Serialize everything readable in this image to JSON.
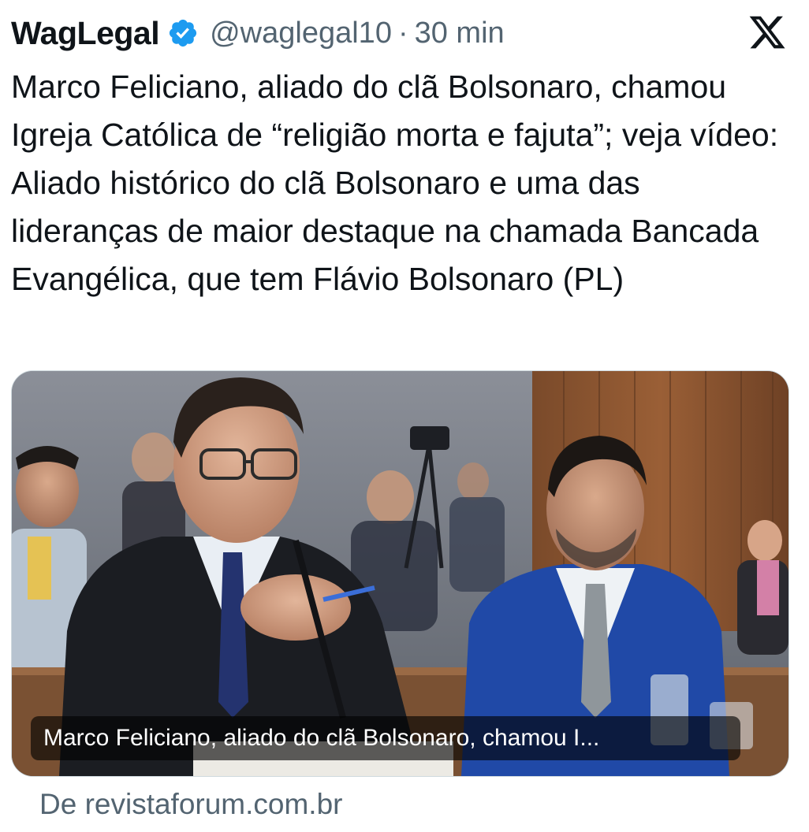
{
  "author": {
    "name": "WagLegal",
    "handle": "@waglegal10",
    "separator": "·",
    "time": "30 min"
  },
  "tweet": {
    "text": "Marco Feliciano, aliado do clã Bolsonaro, chamou Igreja Católica de “religião morta e fajuta”; veja vídeo: Aliado histórico do clã Bolsonaro e uma das lideranças de maior destaque na chamada Bancada Evangélica, que tem Flávio Bolsonaro (PL)"
  },
  "media": {
    "caption": "Marco Feliciano, aliado do clã Bolsonaro, chamou I..."
  },
  "source": {
    "label": "De revistaforum.com.br"
  },
  "icons": {
    "verified": "verified-badge-icon",
    "brand": "x-logo-icon"
  },
  "colors": {
    "verified_blue": "#1d9bf0",
    "secondary_text": "#536471",
    "primary_text": "#0f1419"
  }
}
